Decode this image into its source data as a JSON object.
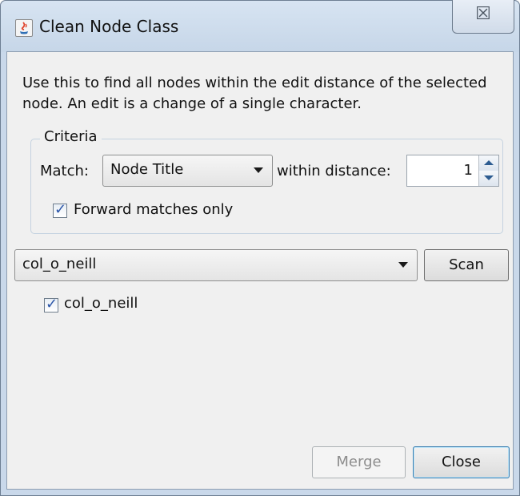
{
  "window": {
    "title": "Clean Node Class",
    "close_glyph": "☒"
  },
  "description": "Use this to find all nodes within the edit distance of the selected node. An edit is a change of a single character.",
  "criteria": {
    "legend": "Criteria",
    "match_label": "Match:",
    "match_value": "Node Title",
    "distance_label": "within distance:",
    "distance_value": "1",
    "forward_label": "Forward matches only",
    "forward_checked": true
  },
  "node_select": {
    "value": "col_o_neill"
  },
  "buttons": {
    "scan": "Scan",
    "merge": "Merge",
    "close": "Close"
  },
  "results": [
    {
      "label": "col_o_neill",
      "checked": true
    }
  ],
  "colors": {
    "window_frame": "#c9d8ea",
    "client_bg": "#f0f0f0",
    "check_accent": "#2b55a8"
  },
  "icons": {
    "app": "java-app-icon",
    "close": "close-icon",
    "dropdown": "chevron-down-icon",
    "spin_up": "spin-up-icon",
    "spin_down": "spin-down-icon"
  }
}
